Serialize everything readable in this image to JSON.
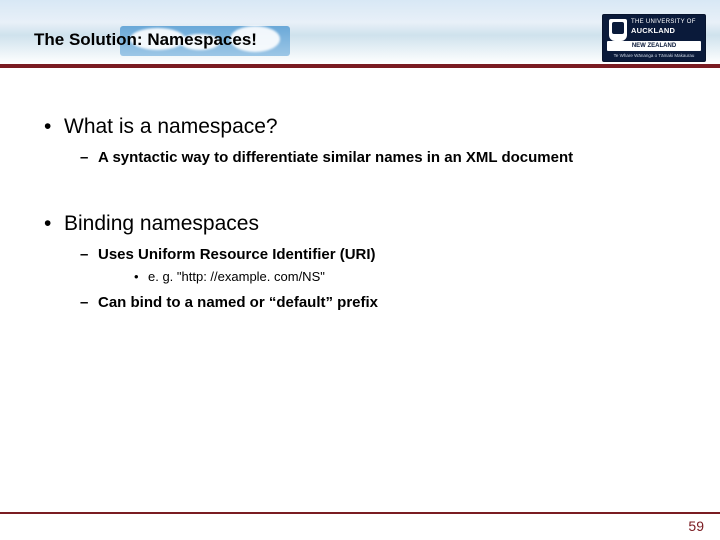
{
  "header": {
    "title": "The Solution: Namespaces!"
  },
  "logo": {
    "line1": "THE UNIVERSITY OF",
    "line2": "AUCKLAND",
    "band": "NEW ZEALAND",
    "maori": "Te Whare Wānanga o Tāmaki Makaurau"
  },
  "content": {
    "b1": {
      "heading": "What is a namespace?",
      "sub1": "A syntactic way to differentiate similar names in an XML document"
    },
    "b2": {
      "heading": "Binding namespaces",
      "sub1": "Uses Uniform Resource Identifier (URI)",
      "sub1ex": "e. g. \"http: //example. com/NS\"",
      "sub2": "Can bind to a named or “default” prefix"
    }
  },
  "footer": {
    "page": "59"
  }
}
